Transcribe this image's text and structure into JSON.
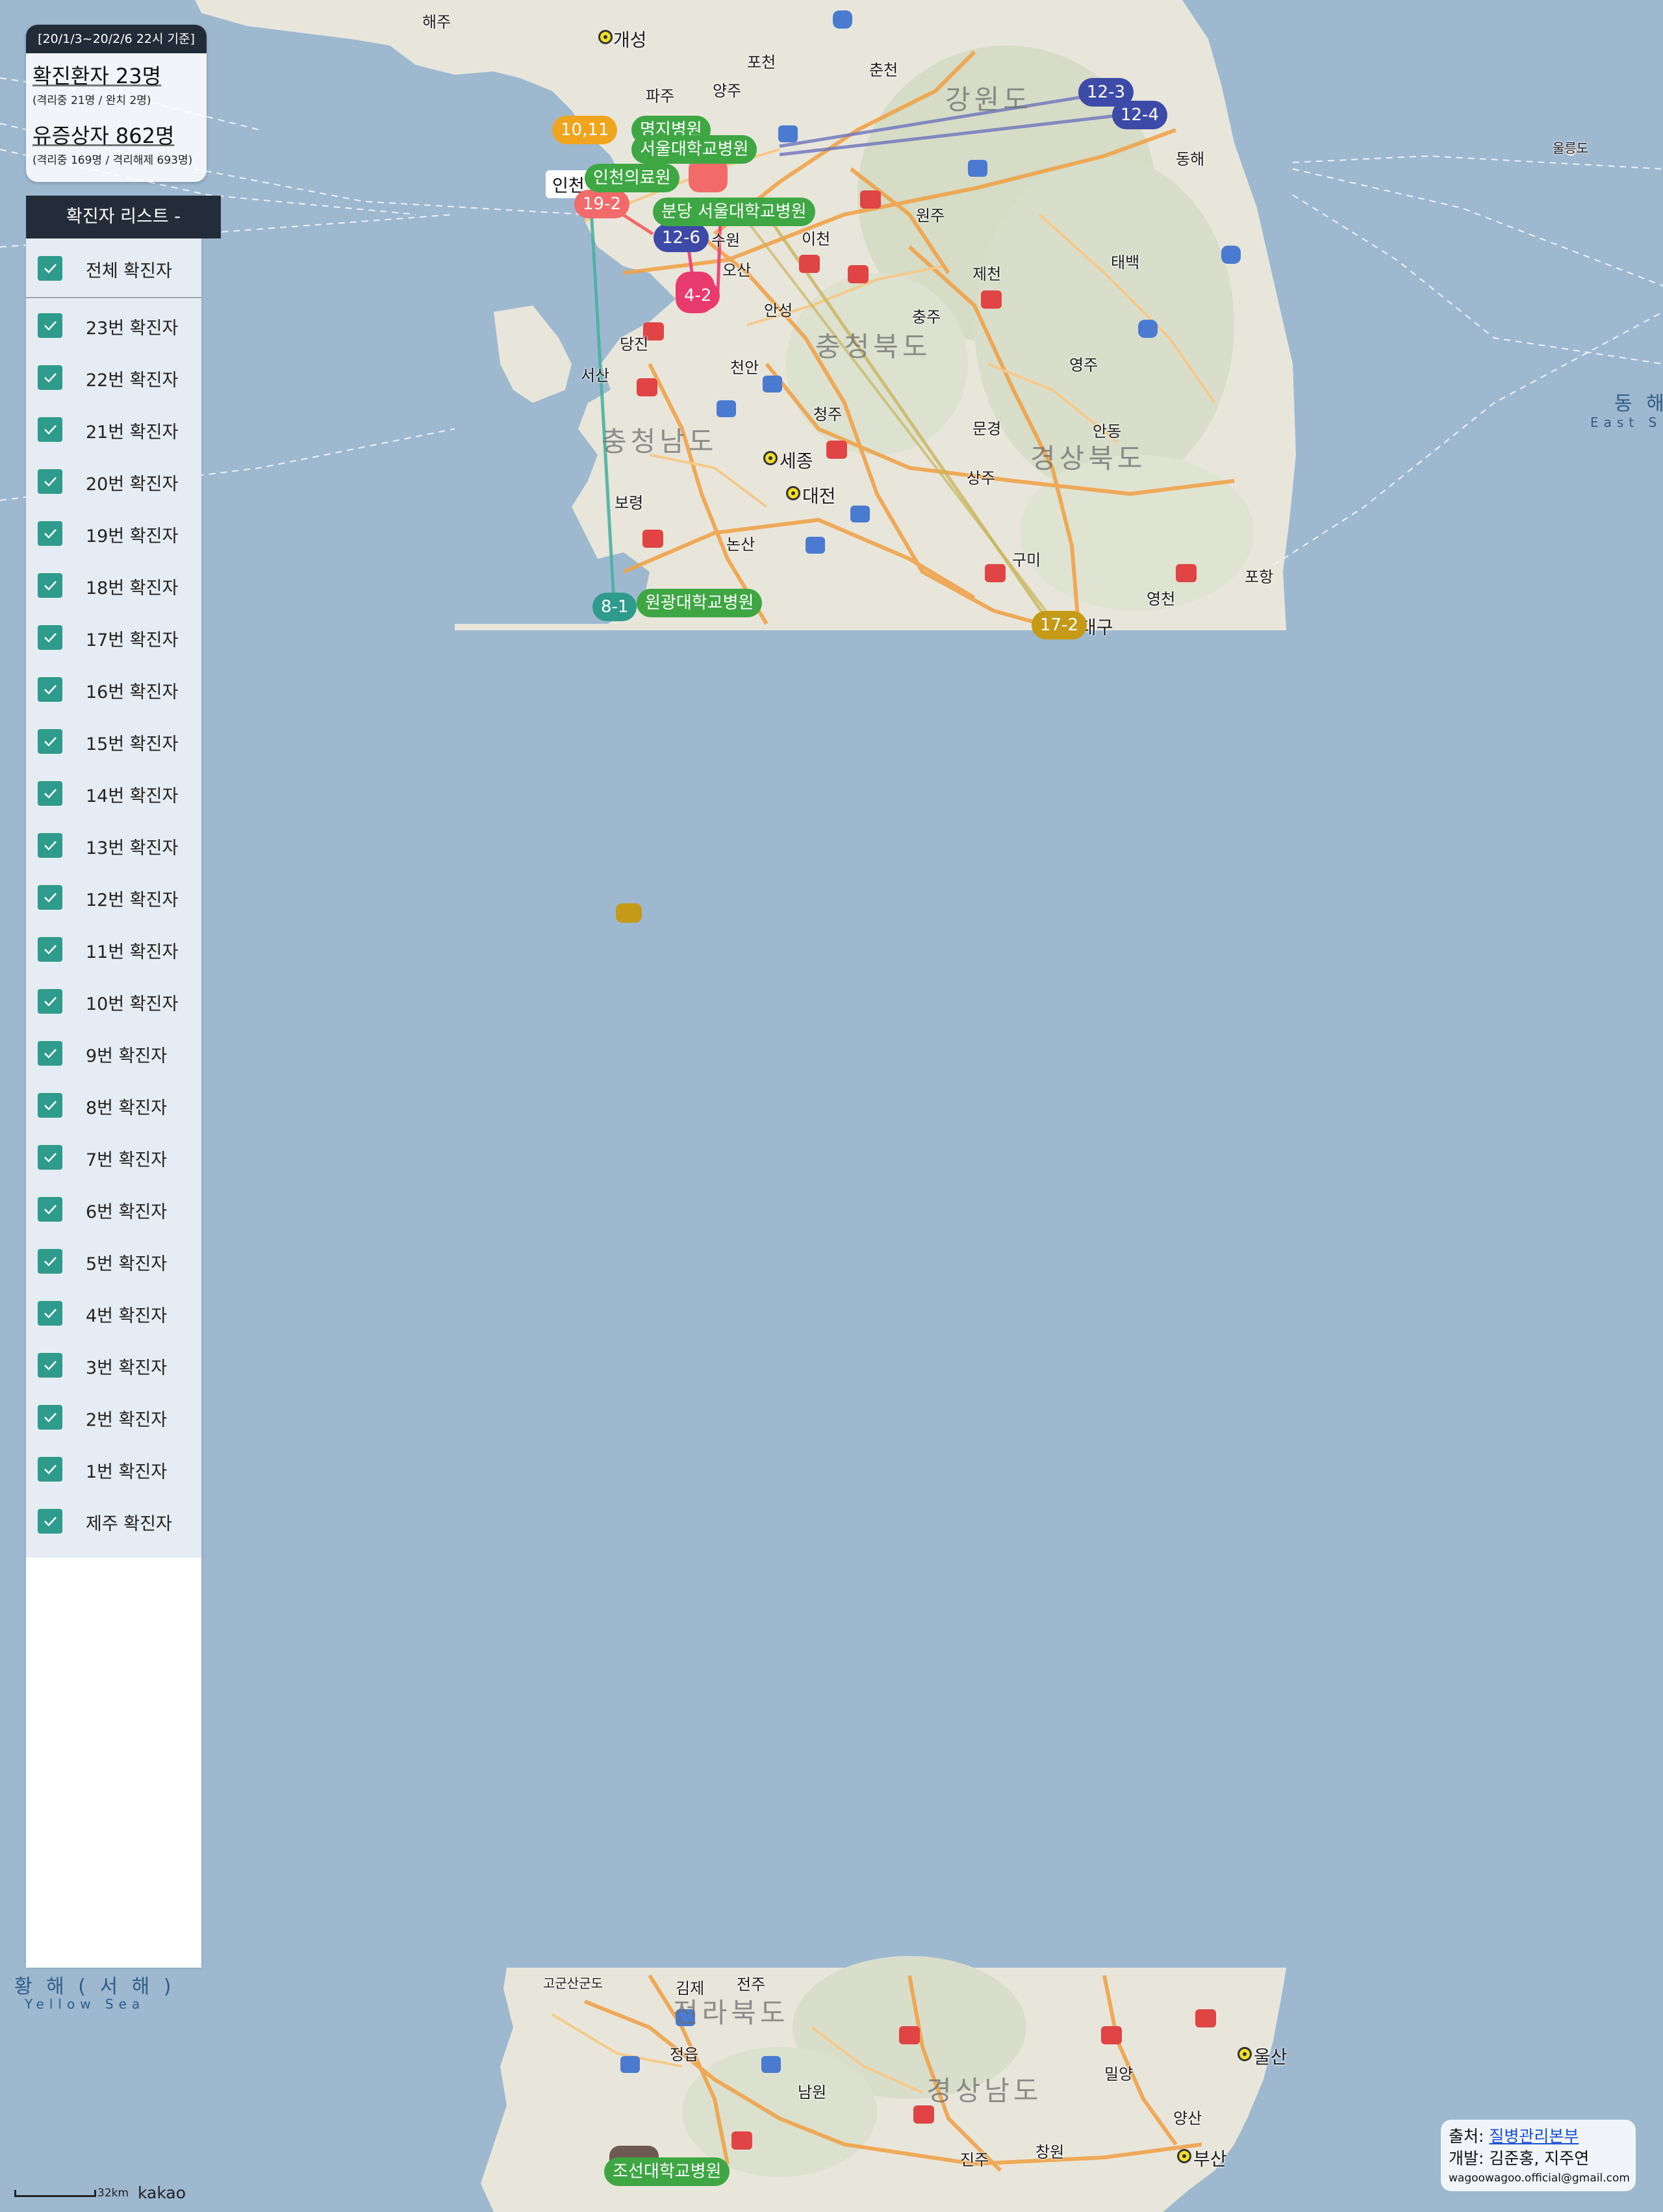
{
  "stats": {
    "date_range": "[20/1/3~20/2/6 22시 기준]",
    "confirmed": "확진환자 23명",
    "confirmed_detail": "(격리중 21명 / 완치 2명)",
    "suspected": "유증상자 862명",
    "suspected_detail": "(격리중 169명 / 격리해제 693명)"
  },
  "patient_list": {
    "header": "확진자 리스트  -",
    "all_label": "전체 확진자",
    "items": [
      "23번 확진자",
      "22번 확진자",
      "21번 확진자",
      "20번 확진자",
      "19번 확진자",
      "18번 확진자",
      "17번 확진자",
      "16번 확진자",
      "15번 확진자",
      "14번 확진자",
      "13번 확진자",
      "12번 확진자",
      "11번 확진자",
      "10번 확진자",
      "9번 확진자",
      "8번 확진자",
      "7번 확진자",
      "6번 확진자",
      "5번 확진자",
      "4번 확진자",
      "3번 확진자",
      "2번 확진자",
      "1번 확진자",
      "제주 확진자"
    ]
  },
  "markers": {
    "m_10_11": "10,11",
    "m_12_3": "12-3",
    "m_12_4": "12-4",
    "m_19_2": "19-2",
    "m_12_6": "12-6",
    "m_4_2": "4-2",
    "m_8_1": "8-1",
    "m_17_2": "17-2"
  },
  "hospitals": {
    "myongji": "명지병원",
    "snuh": "서울대학교병원",
    "incheon": "인천의료원",
    "bundang": "분당 서울대학교병원",
    "wonkwang": "원광대학교병원",
    "chosun": "조선대학교병원"
  },
  "places": {
    "kaesong": "개성",
    "haeju": "해주",
    "pocheon": "포천",
    "yangju": "양주",
    "paju": "파주",
    "chuncheon": "춘천",
    "gangwon": "강원도",
    "donghae": "동해",
    "incheon": "인천",
    "suwon": "수원",
    "osan": "오산",
    "icheon": "이천",
    "wonju": "원주",
    "anseong": "안성",
    "chungju": "충주",
    "jecheon": "제천",
    "taebaek": "태백",
    "yeongju": "영주",
    "dangjin": "당진",
    "seosan": "서산",
    "cheonan": "천안",
    "cheongju": "청주",
    "sejong": "세종",
    "daejeon": "대전",
    "chungbuk": "충청북도",
    "chungnam": "충청남도",
    "boryeong": "보령",
    "nonsan": "논산",
    "mungyeong": "문경",
    "andong": "안동",
    "sangju": "상주",
    "gyeongbuk": "경상북도",
    "gumi": "구미",
    "yeongcheon": "영천",
    "pohang": "포항",
    "daegu": "대구",
    "gimje": "김제",
    "jeonju": "전주",
    "jeonbuk": "전라북도",
    "jeongeup": "정읍",
    "namwon": "남원",
    "gyeongnam": "경상남도",
    "miryang": "밀양",
    "ulsan": "울산",
    "changwon": "창원",
    "busan": "부산",
    "yangsan": "양산",
    "jinju": "진주",
    "gunsan_island": "고군산군도",
    "ulleungdo": "울릉도"
  },
  "seas": {
    "east_sea": "동 해",
    "east_sea_en": "East S",
    "yellow_sea": "황 해 ( 서 해 )",
    "yellow_sea_en": "Yellow Sea"
  },
  "credit": {
    "source_prefix": "출처: ",
    "source_link": "질병관리본부",
    "developers": "개발: 김준홍, 지주연",
    "email": "wagoowagoo.official@gmail.com"
  },
  "scale": {
    "label": "32km",
    "provider": "kakao"
  },
  "colors": {
    "sea": "#9eb8d0",
    "green": "#3ea743",
    "orange": "#f0a51e",
    "indigo": "#3e4aa8",
    "red": "#f26a6a",
    "pink": "#e93a6e",
    "teal": "#2f9b8c",
    "gold": "#c59a17",
    "panel_dark": "#232d3a"
  }
}
